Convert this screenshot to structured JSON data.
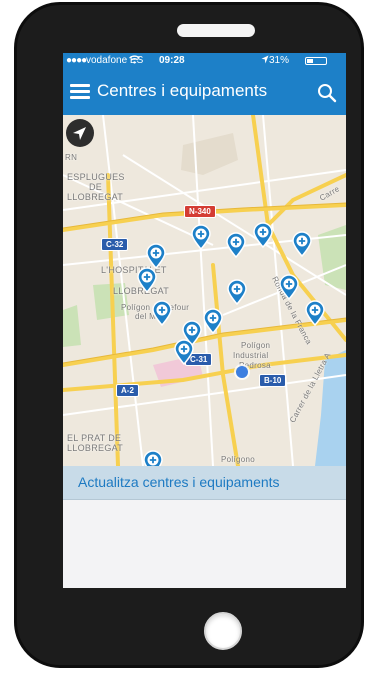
{
  "status_bar": {
    "signal": "●●●●",
    "carrier": "vodafone ES",
    "wifi_icon": "wifi-icon",
    "time": "09:28",
    "location_icon": "location-arrow-icon",
    "battery": "31%"
  },
  "nav_bar": {
    "menu_icon": "hamburger-menu-icon",
    "title": "Centres i equipaments",
    "search_icon": "search-icon"
  },
  "map": {
    "labels": {
      "rn": "RN",
      "esplugues": "ESPLUGUES",
      "de": "DE",
      "llobregat_top": "LLOBREGAT",
      "hospitalet": "L'HOSPITALET",
      "llobregat_mid": "LLOBREGAT",
      "poligon_carrefour_1": "Polígon Carrefour",
      "poligon_carrefour_2": "del Mig",
      "poligon_industrial_1": "Polígon",
      "poligon_industrial_2": "Industrial",
      "poligon_industrial_3": "Pedrosa",
      "prat_1": "EL PRAT DE",
      "prat_2": "LLOBREGAT",
      "poligono_bottom": "Polígono",
      "ronda_franca": "Ronda de la Franca",
      "carrer_lletra": "Carrer de la Lletra A",
      "carrer_top": "Carre"
    },
    "shields": {
      "n340": "N-340",
      "c32": "C-32",
      "c31": "C-31",
      "a2": "A-2",
      "b10": "B-10"
    },
    "colors": {
      "pin": "#1d80c8",
      "shield_red": "#d43c33",
      "shield_blue": "#2a5cab",
      "road_yellow": "#f7d050",
      "user_dot": "#3d7fe0"
    }
  },
  "update_button": {
    "label": "Actualitza centres i equipaments"
  },
  "theme": {
    "accent": "#1d80c8",
    "phone_body": "#1c1c1c"
  }
}
